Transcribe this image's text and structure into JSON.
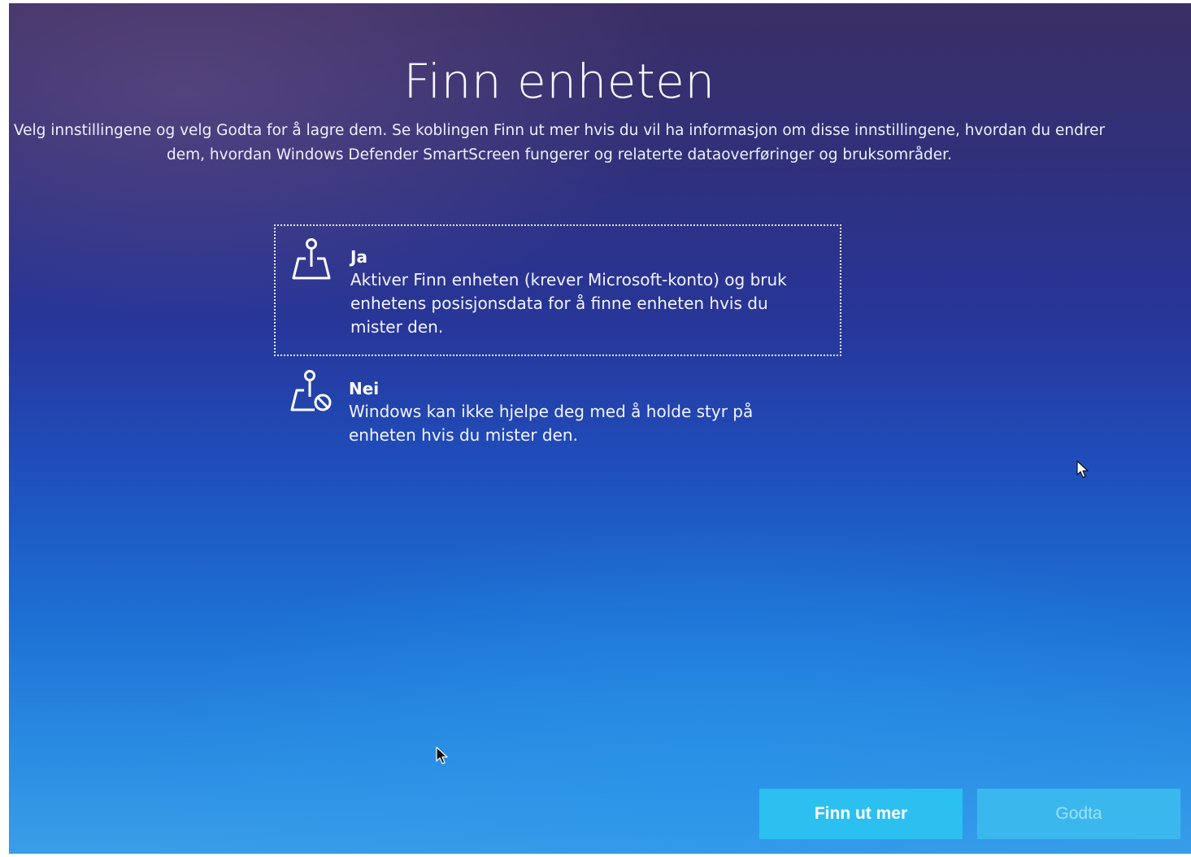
{
  "page": {
    "title": "Finn enheten",
    "description": "Velg innstillingene og velg Godta for å lagre dem. Se koblingen Finn ut mer hvis du vil ha informasjon om disse innstillingene, hvordan du endrer dem, hvordan Windows Defender SmartScreen fungerer og relaterte dataoverføringer og bruksområder."
  },
  "options": {
    "ja": {
      "icon": "location-map-icon",
      "heading": "Ja",
      "description": "Aktiver Finn enheten (krever Microsoft-konto) og bruk enhetens posisjonsdata for å finne enheten hvis du mister den.",
      "selected": true
    },
    "nei": {
      "icon": "location-blocked-icon",
      "heading": "Nei",
      "description": "Windows kan ikke hjelpe deg med å holde styr på enheten hvis du mister den.",
      "selected": false
    }
  },
  "buttons": {
    "learn_more": "Finn ut mer",
    "accept": "Godta"
  },
  "colors": {
    "button_primary": "#2cc0f0",
    "button_disabled": "#3ab8ee"
  }
}
